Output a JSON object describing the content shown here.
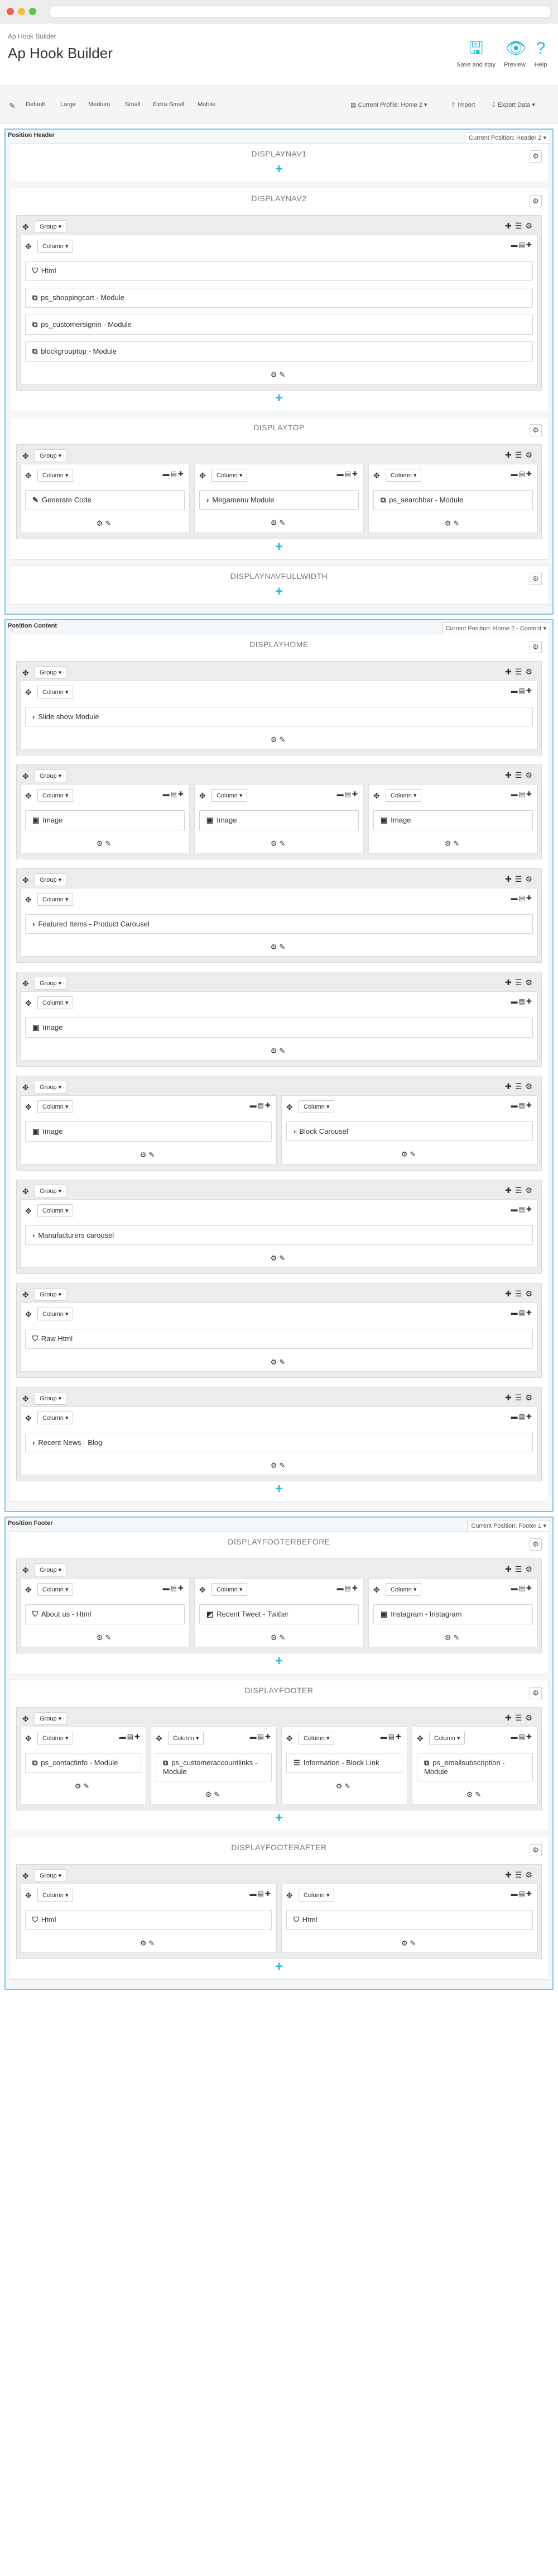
{
  "header": {
    "breadcrumb": "Ap Hook Builder",
    "title": "Ap Hook Builder",
    "save_label": "Save and stay",
    "preview_label": "Preview",
    "help_label": "Help"
  },
  "toolbar": {
    "devices": [
      "Default",
      "Large",
      "Medium",
      "Small",
      "Extra Small",
      "Mobile"
    ],
    "profile": "Current Profile: Home 2 ▾",
    "import": "Import",
    "export": "Export Data ▾"
  },
  "labels": {
    "group": "Group ▾",
    "column": "Column ▾"
  },
  "panels": [
    {
      "label": "Position Header",
      "button": "Current Position: Header 2 ▾",
      "hooks": [
        {
          "title": "DISPLAYNAV1",
          "groups": []
        },
        {
          "title": "DISPLAYNAV2",
          "groups": [
            {
              "columns": [
                {
                  "widgets": [
                    {
                      "icon": "html-icon",
                      "glyph": "⛉",
                      "label": "Html"
                    },
                    {
                      "icon": "module-icon",
                      "glyph": "⧉",
                      "label": "ps_shoppingcart - Module"
                    },
                    {
                      "icon": "module-icon",
                      "glyph": "⧉",
                      "label": "ps_customersignin - Module"
                    },
                    {
                      "icon": "module-icon",
                      "glyph": "⧉",
                      "label": "blockgrouptop - Module"
                    }
                  ]
                }
              ]
            }
          ]
        },
        {
          "title": "DISPLAYTOP",
          "groups": [
            {
              "columns": [
                {
                  "widgets": [
                    {
                      "icon": "code-icon",
                      "glyph": "✎",
                      "label": "Generate Code"
                    }
                  ]
                },
                {
                  "widgets": [
                    {
                      "icon": "chevron-right-icon",
                      "glyph": "›",
                      "label": "Megamenu Module"
                    }
                  ]
                },
                {
                  "widgets": [
                    {
                      "icon": "module-icon",
                      "glyph": "⧉",
                      "label": "ps_searchbar - Module"
                    }
                  ]
                }
              ]
            }
          ]
        },
        {
          "title": "DISPLAYNAVFULLWIDTH",
          "groups": []
        }
      ]
    },
    {
      "label": "Position Content",
      "button": "Current Position: Home 2 - Content ▾",
      "hooks": [
        {
          "title": "DISPLAYHOME",
          "groups": [
            {
              "columns": [
                {
                  "widgets": [
                    {
                      "icon": "chevron-right-icon",
                      "glyph": "›",
                      "label": "Slide show Module"
                    }
                  ]
                }
              ]
            },
            {
              "columns": [
                {
                  "widgets": [
                    {
                      "icon": "image-icon",
                      "glyph": "▣",
                      "label": "Image"
                    }
                  ]
                },
                {
                  "widgets": [
                    {
                      "icon": "image-icon",
                      "glyph": "▣",
                      "label": "Image"
                    }
                  ]
                },
                {
                  "widgets": [
                    {
                      "icon": "image-icon",
                      "glyph": "▣",
                      "label": "Image"
                    }
                  ]
                }
              ]
            },
            {
              "columns": [
                {
                  "widgets": [
                    {
                      "icon": "chevron-right-icon",
                      "glyph": "›",
                      "label": "Featured Items - Product Carousel"
                    }
                  ]
                }
              ]
            },
            {
              "columns": [
                {
                  "widgets": [
                    {
                      "icon": "image-icon",
                      "glyph": "▣",
                      "label": "Image"
                    }
                  ]
                }
              ]
            },
            {
              "columns": [
                {
                  "widgets": [
                    {
                      "icon": "image-icon",
                      "glyph": "▣",
                      "label": "Image"
                    }
                  ]
                },
                {
                  "widgets": [
                    {
                      "icon": "chevron-right-icon",
                      "glyph": "›",
                      "label": "Block Carousel"
                    }
                  ]
                }
              ]
            },
            {
              "columns": [
                {
                  "widgets": [
                    {
                      "icon": "chevron-right-icon",
                      "glyph": "›",
                      "label": "Manufacturers carousel"
                    }
                  ]
                }
              ]
            },
            {
              "columns": [
                {
                  "widgets": [
                    {
                      "icon": "html-icon",
                      "glyph": "⛉",
                      "label": "Raw Html"
                    }
                  ]
                }
              ]
            },
            {
              "columns": [
                {
                  "widgets": [
                    {
                      "icon": "chevron-right-icon",
                      "glyph": "›",
                      "label": "Recent News - Blog"
                    }
                  ]
                }
              ]
            }
          ]
        }
      ]
    },
    {
      "label": "Position Footer",
      "button": "Current Position: Footer 1 ▾",
      "hooks": [
        {
          "title": "DISPLAYFOOTERBEFORE",
          "groups": [
            {
              "columns": [
                {
                  "widgets": [
                    {
                      "icon": "html-icon",
                      "glyph": "⛉",
                      "label": "About us - Html"
                    }
                  ]
                },
                {
                  "widgets": [
                    {
                      "icon": "twitter-icon",
                      "glyph": "◩",
                      "label": "Recent Tweet - Twitter"
                    }
                  ]
                },
                {
                  "widgets": [
                    {
                      "icon": "instagram-icon",
                      "glyph": "▣",
                      "label": "Instagram - Instagram"
                    }
                  ]
                }
              ]
            }
          ]
        },
        {
          "title": "DISPLAYFOOTER",
          "groups": [
            {
              "columns": [
                {
                  "widgets": [
                    {
                      "icon": "module-icon",
                      "glyph": "⧉",
                      "label": "ps_contactinfo - Module"
                    }
                  ]
                },
                {
                  "widgets": [
                    {
                      "icon": "module-icon",
                      "glyph": "⧉",
                      "label": "ps_customeraccountlinks - Module"
                    }
                  ]
                },
                {
                  "widgets": [
                    {
                      "icon": "list-icon",
                      "glyph": "☰",
                      "label": "Information - Block Link"
                    }
                  ]
                },
                {
                  "widgets": [
                    {
                      "icon": "module-icon",
                      "glyph": "⧉",
                      "label": "ps_emailsubscription - Module"
                    }
                  ]
                }
              ]
            }
          ]
        },
        {
          "title": "DISPLAYFOOTERAFTER",
          "groups": [
            {
              "columns": [
                {
                  "widgets": [
                    {
                      "icon": "html-icon",
                      "glyph": "⛉",
                      "label": "Html"
                    }
                  ]
                },
                {
                  "widgets": [
                    {
                      "icon": "html-icon",
                      "glyph": "⛉",
                      "label": "Html"
                    }
                  ]
                }
              ]
            }
          ]
        }
      ]
    }
  ]
}
